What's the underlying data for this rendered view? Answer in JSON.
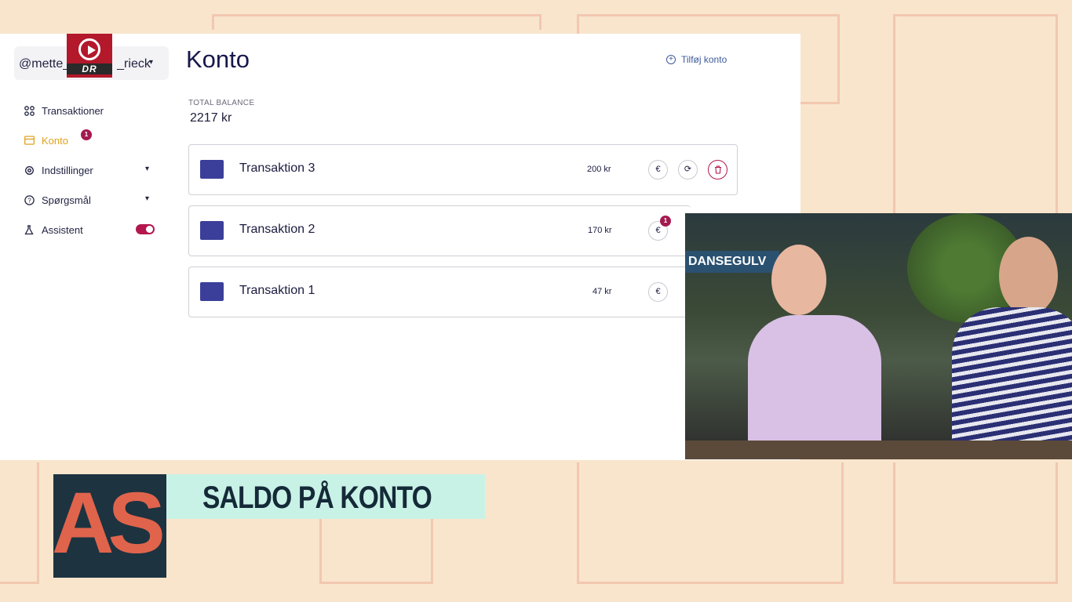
{
  "sidebar": {
    "account": "@mette_",
    "account_suffix": "_rieck",
    "items": [
      {
        "label": "Transaktioner"
      },
      {
        "label": "Konto",
        "badge": "1"
      },
      {
        "label": "Indstillinger"
      },
      {
        "label": "Spørgsmål"
      },
      {
        "label": "Assistent"
      }
    ]
  },
  "channel_logo": {
    "text": "DR"
  },
  "header": {
    "title": "Konto",
    "add_account": "Tilføj konto"
  },
  "balance": {
    "label": "TOTAL BALANCE",
    "value": "2217 kr"
  },
  "transactions": [
    {
      "name": "Transaktion 3",
      "amount": "200 kr",
      "actions": [
        "euro-icon",
        "refresh-icon",
        "trash-icon"
      ]
    },
    {
      "name": "Transaktion 2",
      "amount": "170 kr",
      "actions": [
        "euro-icon"
      ],
      "badge": "1"
    },
    {
      "name": "Transaktion 1",
      "amount": "47 kr",
      "actions": [
        "euro-icon"
      ]
    }
  ],
  "video": {
    "sign_text": "DANSEGULV"
  },
  "show": {
    "logo": "AS",
    "caption": "SALDO PÅ KONTO"
  },
  "colors": {
    "background": "#f8e5cc",
    "accent_active": "#e0a21f",
    "badge": "#a31a4f",
    "caption_bg": "#c9f2e6",
    "card_icon": "#3b3f9a"
  }
}
